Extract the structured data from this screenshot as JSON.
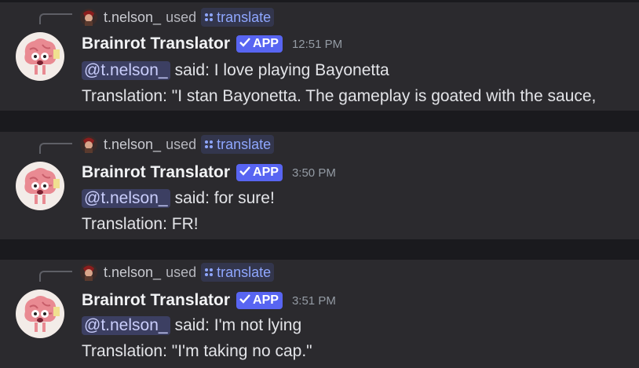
{
  "messages": [
    {
      "reply": {
        "user": "t.nelson_",
        "used": "used",
        "command": "translate"
      },
      "author": "Brainrot Translator",
      "badge": "APP",
      "time": "12:51 PM",
      "mention": "@t.nelson_",
      "said": "said: I love playing Bayonetta",
      "translation": "Translation: \"I stan Bayonetta. The gameplay is goated with the sauce,"
    },
    {
      "reply": {
        "user": "t.nelson_",
        "used": "used",
        "command": "translate"
      },
      "author": "Brainrot Translator",
      "badge": "APP",
      "time": "3:50 PM",
      "mention": "@t.nelson_",
      "said": "said: for sure!",
      "translation": "Translation: FR!"
    },
    {
      "reply": {
        "user": "t.nelson_",
        "used": "used",
        "command": "translate"
      },
      "author": "Brainrot Translator",
      "badge": "APP",
      "time": "3:51 PM",
      "mention": "@t.nelson_",
      "said": "said: I'm not lying",
      "translation": "Translation: \"I'm taking no cap.\""
    }
  ],
  "icons": {
    "bot_avatar": "brain-character-icon",
    "user_avatar": "user-avatar-icon",
    "command": "slash-command-icon",
    "badge": "checkmark-icon"
  },
  "colors": {
    "message_bg": "#2b2a2e",
    "page_bg": "#1a1a1e",
    "brand": "#5865f2",
    "mention_bg": "#3c3f62",
    "command_text": "#8fa7ff"
  }
}
